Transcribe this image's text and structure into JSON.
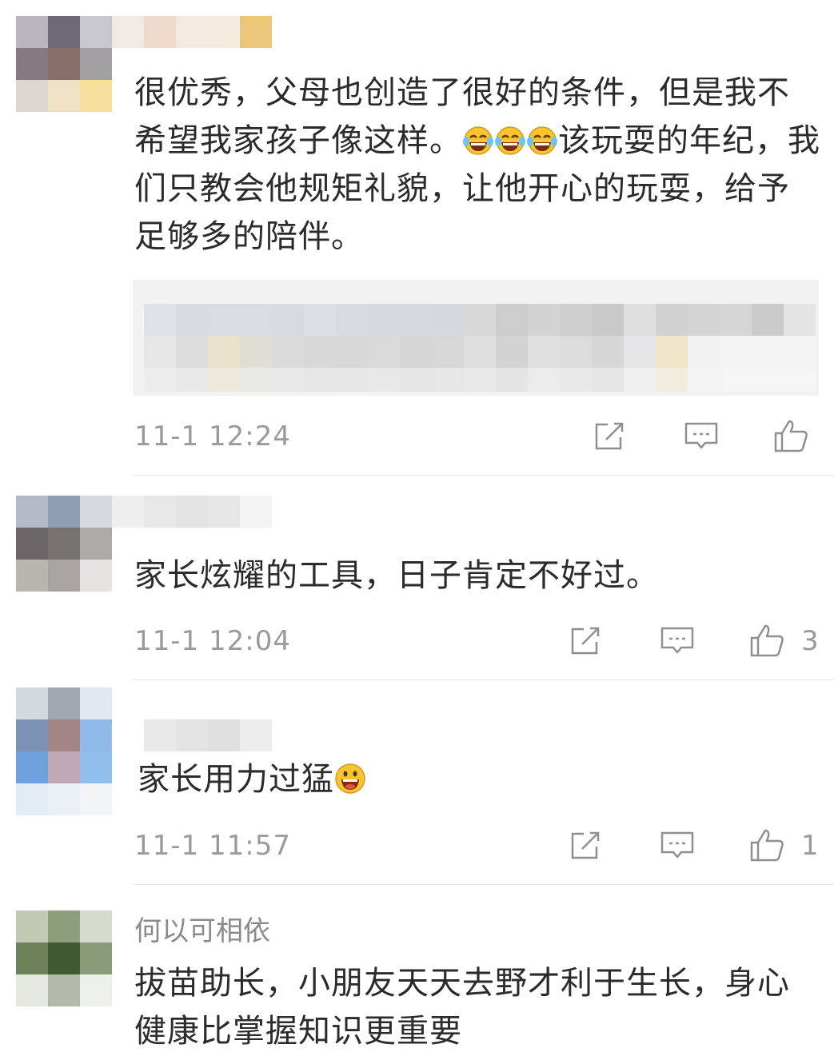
{
  "comments": [
    {
      "username": "",
      "text": "很优秀，父母也创造了很好的条件，但是我不希望我家孩子像这样。",
      "text_after_emoji": "该玩耍的年纪，我们只教会他规矩礼貌，让他开心的玩耍，给予足够多的陪伴。",
      "emoji_icons": [
        "tears-of-joy-emoji",
        "tears-of-joy-emoji",
        "tears-of-joy-emoji"
      ],
      "time": "11-1 12:24",
      "like_count": ""
    },
    {
      "username": "",
      "text": "家长炫耀的工具，日子肯定不好过。",
      "time": "11-1 12:04",
      "like_count": "3"
    },
    {
      "username": "",
      "text": "家长用力过猛",
      "emoji_icons": [
        "grinning-emoji"
      ],
      "time": "11-1 11:57",
      "like_count": "1"
    },
    {
      "username": "何以可相依",
      "text": "拔苗助长，小朋友天天去野才利于生长，身心健康比掌握知识更重要",
      "time": "",
      "like_count": ""
    }
  ],
  "icons": {
    "share": "share-icon",
    "reply": "reply-icon",
    "like": "thumbs-up-icon"
  },
  "colors": {
    "text": "#2b2b2b",
    "meta": "#9a9a9a",
    "divider": "#e6e6e6",
    "quote_bg": "#f2f2f2"
  }
}
